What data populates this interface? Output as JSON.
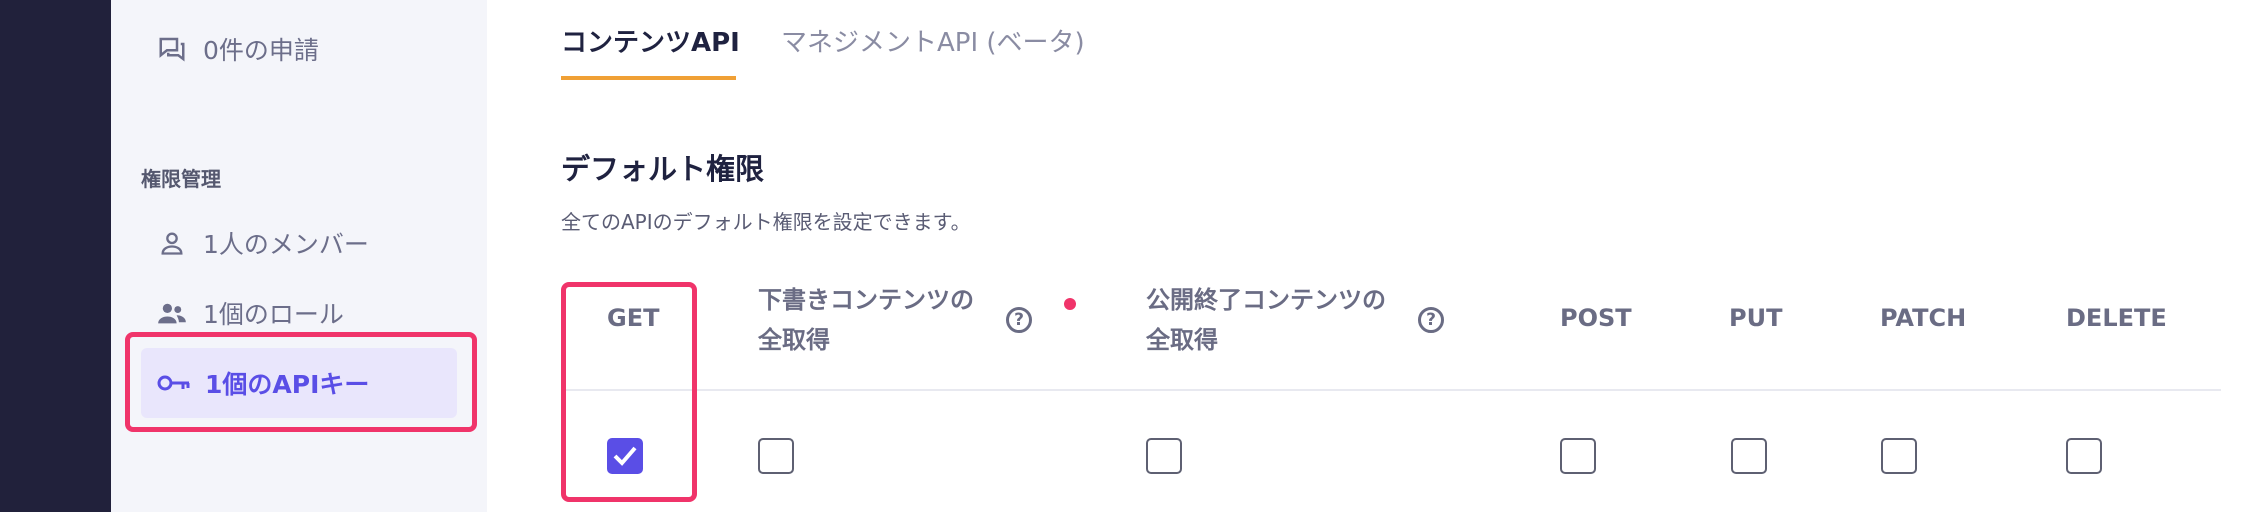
{
  "sidebar": {
    "requests_label": "0件の申請",
    "section_label": "権限管理",
    "members_label": "1人のメンバー",
    "roles_label": "1個のロール",
    "api_keys_label": "1個のAPIキー"
  },
  "tabs": [
    {
      "label": "コンテンツAPI",
      "active": true
    },
    {
      "label": "マネジメントAPI (ベータ)",
      "active": false
    }
  ],
  "main": {
    "heading": "デフォルト権限",
    "description": "全てのAPIのデフォルト権限を設定できます。"
  },
  "permissions": {
    "columns": [
      {
        "label": "GET",
        "checked": true
      },
      {
        "label_line1": "下書きコンテンツの",
        "label_line2": "全取得",
        "checked": false,
        "help": true
      },
      {
        "label_line1": "公開終了コンテンツの",
        "label_line2": "全取得",
        "checked": false,
        "help": true
      },
      {
        "label": "POST",
        "checked": false
      },
      {
        "label": "PUT",
        "checked": false
      },
      {
        "label": "PATCH",
        "checked": false
      },
      {
        "label": "DELETE",
        "checked": false
      }
    ],
    "help_glyph": "?"
  },
  "colors": {
    "accent": "#5a4ee6",
    "highlight": "#f0346a",
    "tab_underline": "#f0a035",
    "rail": "#21213b"
  }
}
